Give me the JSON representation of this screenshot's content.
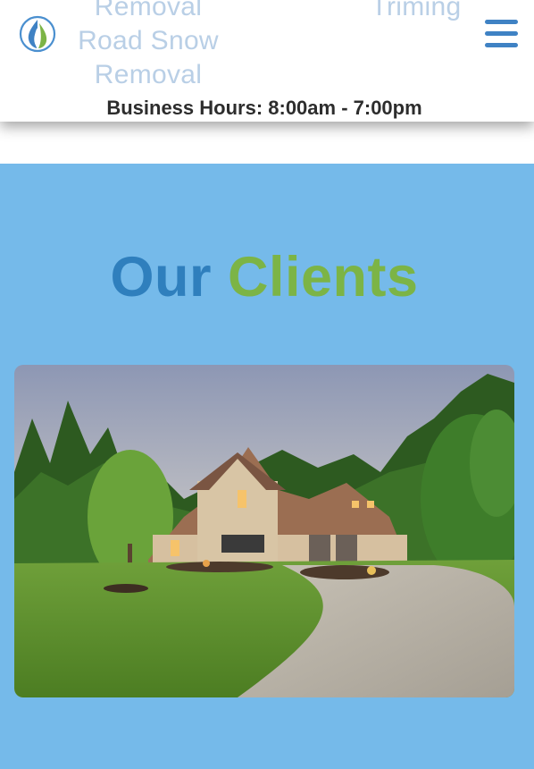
{
  "header": {
    "logo_icon": "water-leaf-drop-logo",
    "nav_left_lines": [
      "Removal",
      "Road Snow",
      "Removal"
    ],
    "nav_right_lines": [
      "Triming"
    ],
    "menu_icon": "hamburger-menu-icon",
    "business_hours": "Business Hours: 8:00am - 7:00pm"
  },
  "clients": {
    "title_part1": "Our",
    "title_part2": "Clients",
    "image_subject": "house-photo"
  },
  "colors": {
    "section_bg": "#75baea",
    "title_blue": "#2f7fbd",
    "title_green": "#7cb446",
    "nav_text": "#b9cfe6",
    "menu_icon": "#3f82c4"
  }
}
